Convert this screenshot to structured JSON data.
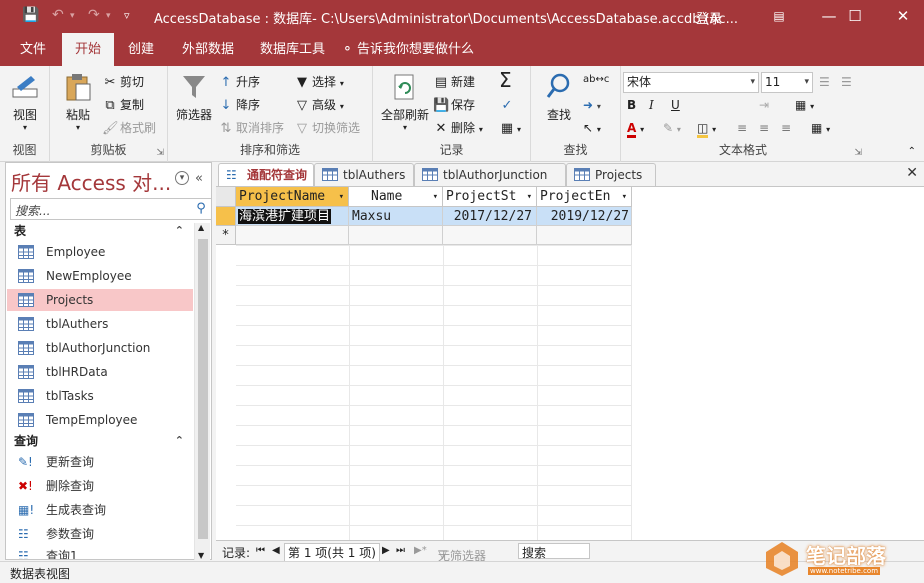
{
  "window": {
    "title": "AccessDatabase : 数据库- C:\\Users\\Administrator\\Documents\\AccessDatabase.accdb (Ac...",
    "login": "登录",
    "controls": [
      "—",
      "☐",
      "✕"
    ]
  },
  "menu_tabs": [
    "文件",
    "开始",
    "创建",
    "外部数据",
    "数据库工具"
  ],
  "tell_me": "告诉我你想要做什么",
  "ribbon": {
    "view": {
      "label": "视图",
      "group": "视图"
    },
    "clipboard": {
      "paste": "粘贴",
      "cut": "剪切",
      "copy": "复制",
      "format_painter": "格式刷",
      "group": "剪贴板"
    },
    "sort_filter": {
      "filter": "筛选器",
      "ascending": "升序",
      "descending": "降序",
      "remove_sort": "取消排序",
      "select": "选择",
      "advanced": "高级",
      "toggle_filter": "切换筛选",
      "group": "排序和筛选"
    },
    "records": {
      "refresh_all": "全部刷新",
      "new": "新建",
      "save": "保存",
      "delete": "删除",
      "group": "记录"
    },
    "find": {
      "find": "查找",
      "group": "查找"
    },
    "text_format": {
      "font": "宋体",
      "size": "11",
      "group": "文本格式"
    }
  },
  "nav_pane": {
    "title": "所有 Access 对...",
    "search_placeholder": "搜索...",
    "sections": [
      {
        "label": "表",
        "items": [
          "Employee",
          "NewEmployee",
          "Projects",
          "tblAuthers",
          "tblAuthorJunction",
          "tblHRData",
          "tblTasks",
          "TempEmployee"
        ]
      },
      {
        "label": "查询",
        "items": [
          "更新查询",
          "删除查询",
          "生成表查询",
          "参数查询",
          "查询1"
        ]
      }
    ],
    "selected": "Projects"
  },
  "doc_tabs": [
    "通配符查询",
    "tblAuthers",
    "tblAuthorJunction",
    "Projects"
  ],
  "datasheet": {
    "columns": [
      "ProjectName",
      "Name",
      "ProjectSt",
      "ProjectEn"
    ],
    "rows": [
      [
        "海滨港扩建项目",
        "Maxsu",
        "2017/12/27",
        "2019/12/27"
      ]
    ],
    "new_row_marker": "*"
  },
  "record_nav": {
    "label": "记录:",
    "position": "第 1 项(共 1 项)",
    "filter": "无筛选器",
    "search": "搜索"
  },
  "status_bar": {
    "text": "数据表视图"
  },
  "watermark": {
    "text": "笔记部落",
    "sub": "www.notetribe.com"
  },
  "colors": {
    "accent": "#a4373a",
    "selected_row": "#c9e0f7",
    "nav_selected": "#f8c7c8"
  }
}
